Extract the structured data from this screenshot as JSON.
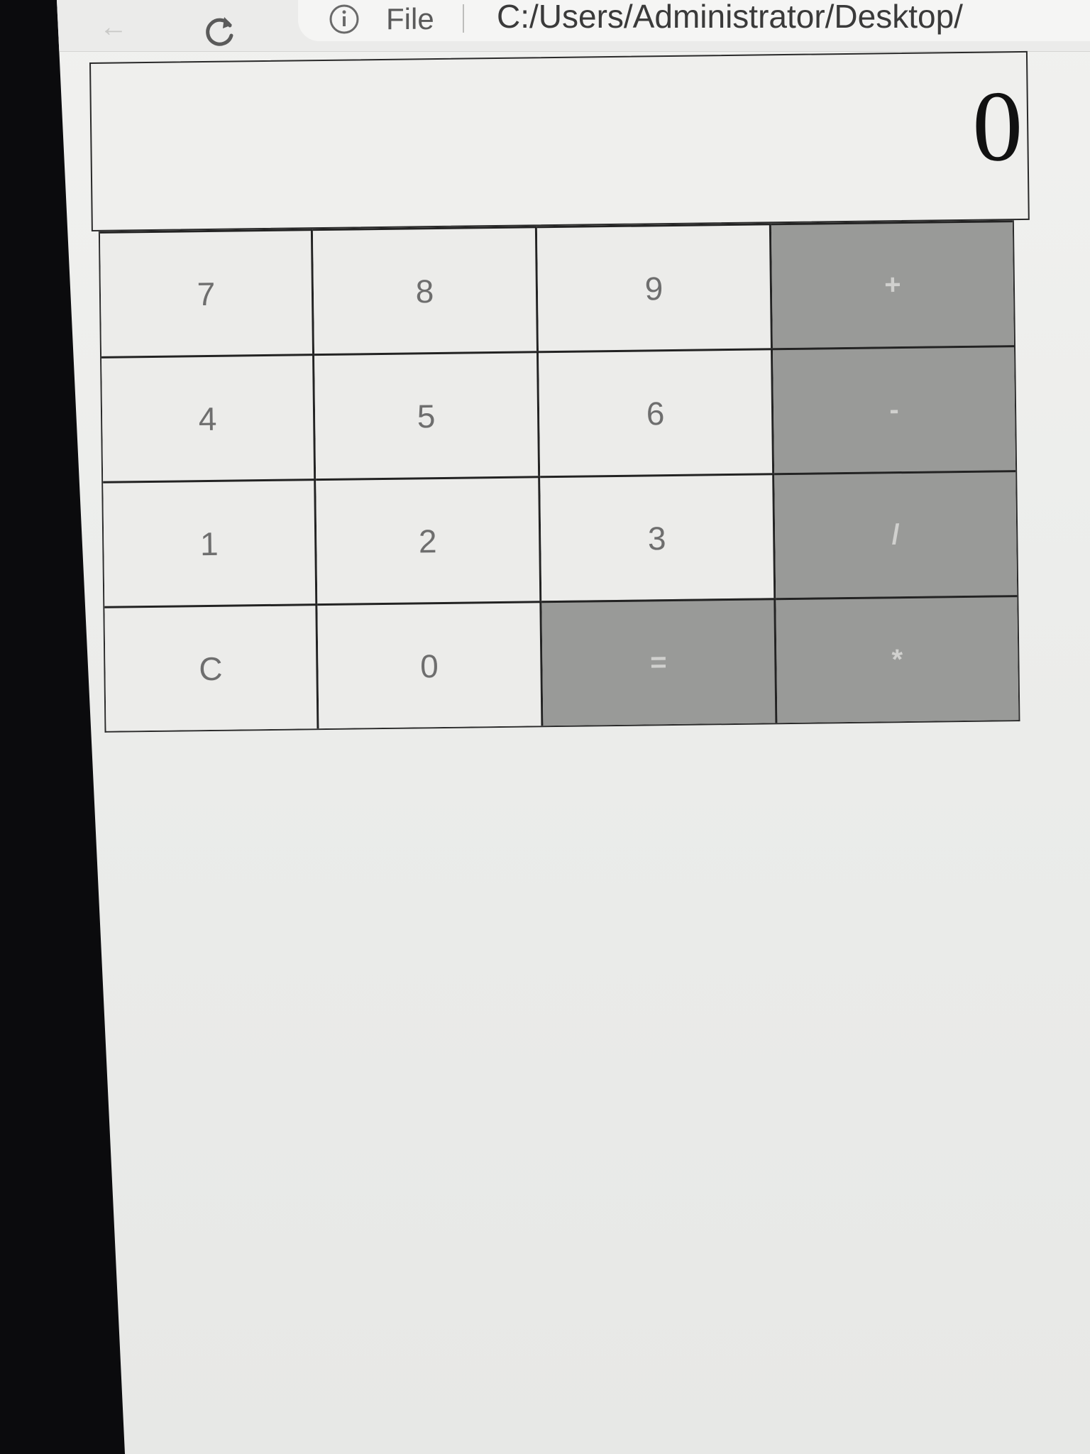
{
  "browser": {
    "back_glyph": "←",
    "reload_icon": "reload-icon",
    "info_icon": "info-icon",
    "scheme_label": "File",
    "url": "C:/Users/Administrator/Desktop/"
  },
  "calculator": {
    "display": "0",
    "keys": [
      {
        "label": "7",
        "kind": "digit"
      },
      {
        "label": "8",
        "kind": "digit"
      },
      {
        "label": "9",
        "kind": "digit"
      },
      {
        "label": "+",
        "kind": "operator"
      },
      {
        "label": "4",
        "kind": "digit"
      },
      {
        "label": "5",
        "kind": "digit"
      },
      {
        "label": "6",
        "kind": "digit"
      },
      {
        "label": "-",
        "kind": "operator"
      },
      {
        "label": "1",
        "kind": "digit"
      },
      {
        "label": "2",
        "kind": "digit"
      },
      {
        "label": "3",
        "kind": "digit"
      },
      {
        "label": "/",
        "kind": "operator"
      },
      {
        "label": "C",
        "kind": "clear"
      },
      {
        "label": "0",
        "kind": "digit"
      },
      {
        "label": "=",
        "kind": "operator"
      },
      {
        "label": "*",
        "kind": "operator"
      }
    ]
  },
  "colors": {
    "operator_key": "#999a98",
    "digit_key": "#ececea",
    "border": "#232323"
  }
}
